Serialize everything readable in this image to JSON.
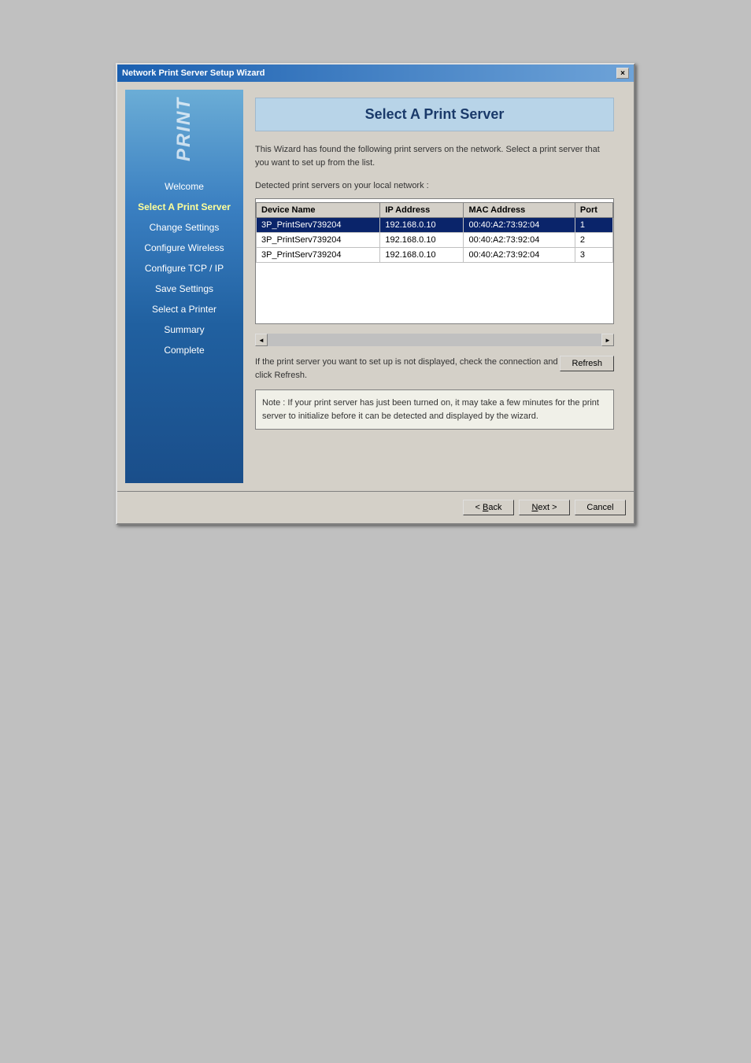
{
  "window": {
    "title": "Network Print Server Setup Wizard",
    "close_label": "×"
  },
  "sidebar": {
    "logo_text": "PRINT",
    "items": [
      {
        "label": "Welcome",
        "active": false
      },
      {
        "label": "Select A Print Server",
        "active": true
      },
      {
        "label": "Change Settings",
        "active": false
      },
      {
        "label": "Configure Wireless",
        "active": false
      },
      {
        "label": "Configure TCP / IP",
        "active": false
      },
      {
        "label": "Save Settings",
        "active": false
      },
      {
        "label": "Select a Printer",
        "active": false
      },
      {
        "label": "Summary",
        "active": false
      },
      {
        "label": "Complete",
        "active": false
      }
    ]
  },
  "main": {
    "page_title": "Select A Print Server",
    "description": "This Wizard has found the following print servers on the network. Select a print server that you want to set up from the list.",
    "section_label": "Detected print servers on your local network :",
    "table": {
      "columns": [
        "Device Name",
        "IP Address",
        "MAC Address",
        "Port"
      ],
      "rows": [
        {
          "device": "3P_PrintServ739204",
          "ip": "192.168.0.10",
          "mac": "00:40:A2:73:92:04",
          "port": "1",
          "selected": true
        },
        {
          "device": "3P_PrintServ739204",
          "ip": "192.168.0.10",
          "mac": "00:40:A2:73:92:04",
          "port": "2",
          "selected": false
        },
        {
          "device": "3P_PrintServ739204",
          "ip": "192.168.0.10",
          "mac": "00:40:A2:73:92:04",
          "port": "3",
          "selected": false
        }
      ]
    },
    "refresh_prompt": "If the print server you want to set up is not displayed, check the connection and click Refresh.",
    "refresh_button": "Refresh",
    "note": "Note : If your print server has just been turned on, it may take a few minutes for the print server to initialize before it can be detected and displayed by the wizard."
  },
  "footer": {
    "back_label": "< Back",
    "next_label": "Next >",
    "cancel_label": "Cancel"
  }
}
